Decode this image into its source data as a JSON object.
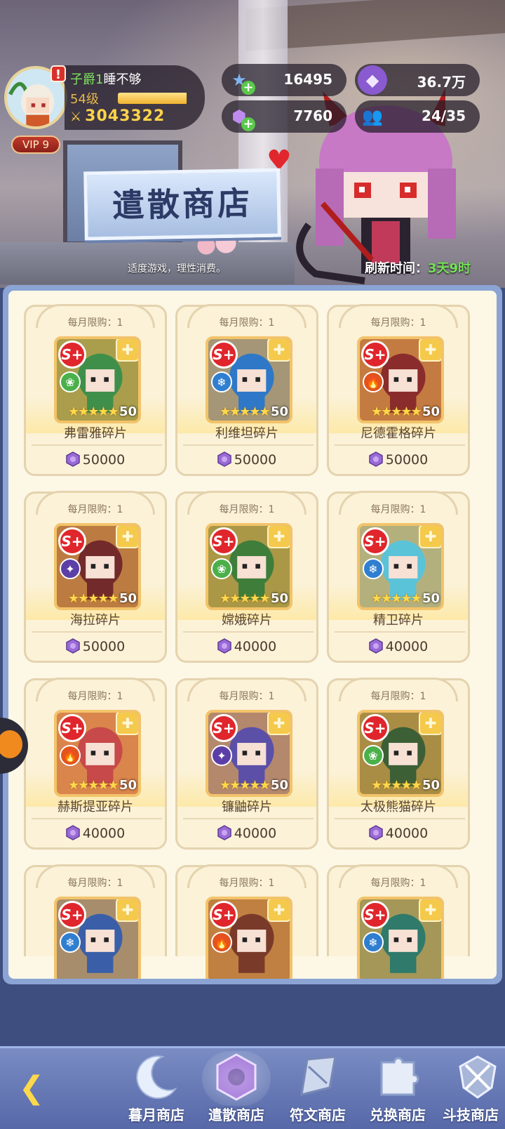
{
  "player": {
    "title": "子爵1",
    "name": "睡不够",
    "level": "54级",
    "exp_fraction": 0.98,
    "power": "3043322",
    "vip": "VIP 9",
    "alert": "!"
  },
  "resources": {
    "star": "16495",
    "crystal": "36.7万",
    "gem": "7760",
    "team": "24/35"
  },
  "store": {
    "title": "遣散商店",
    "notice": "适度游戏，理性消费。",
    "refresh_label": "刷新时间：",
    "refresh_value": "3天9时"
  },
  "items": [
    {
      "limit": "每月限购：1",
      "name": "弗雷雅碎片",
      "price": "50000",
      "rank": "S+",
      "element": "wind",
      "stars": "★★★★★",
      "level": "50"
    },
    {
      "limit": "每月限购：1",
      "name": "利维坦碎片",
      "price": "50000",
      "rank": "S+",
      "element": "ice",
      "stars": "★★★★★",
      "level": "50"
    },
    {
      "limit": "每月限购：1",
      "name": "尼德霍格碎片",
      "price": "50000",
      "rank": "S+",
      "element": "fire",
      "stars": "★★★★★",
      "level": "50"
    },
    {
      "limit": "每月限购：1",
      "name": "海拉碎片",
      "price": "50000",
      "rank": "S+",
      "element": "dark",
      "stars": "★★★★★",
      "level": "50"
    },
    {
      "limit": "每月限购：1",
      "name": "嫦娥碎片",
      "price": "40000",
      "rank": "S+",
      "element": "wind",
      "stars": "★★★★★",
      "level": "50"
    },
    {
      "limit": "每月限购：1",
      "name": "精卫碎片",
      "price": "40000",
      "rank": "S+",
      "element": "ice",
      "stars": "★★★★★",
      "level": "50"
    },
    {
      "limit": "每月限购：1",
      "name": "赫斯提亚碎片",
      "price": "40000",
      "rank": "S+",
      "element": "fire",
      "stars": "★★★★★",
      "level": "50"
    },
    {
      "limit": "每月限购：1",
      "name": "镰鼬碎片",
      "price": "40000",
      "rank": "S+",
      "element": "dark",
      "stars": "★★★★★",
      "level": "50"
    },
    {
      "limit": "每月限购：1",
      "name": "太极熊猫碎片",
      "price": "40000",
      "rank": "S+",
      "element": "wind",
      "stars": "★★★★★",
      "level": "50"
    },
    {
      "limit": "每月限购：1",
      "rank": "S+",
      "element": "ice"
    },
    {
      "limit": "每月限购：1",
      "rank": "S+",
      "element": "fire"
    },
    {
      "limit": "每月限购：1",
      "rank": "S+",
      "element": "ice"
    }
  ],
  "nav": [
    {
      "label": "暮月商店",
      "icon": "moon-icon",
      "active": false
    },
    {
      "label": "遣散商店",
      "icon": "crystal-icon",
      "active": true
    },
    {
      "label": "符文商店",
      "icon": "rune-icon",
      "active": false
    },
    {
      "label": "兑换商店",
      "icon": "puzzle-icon",
      "active": false
    },
    {
      "label": "斗技商店",
      "icon": "arena-icon",
      "active": false
    }
  ],
  "colors": {
    "accent_green": "#77e25a",
    "gold": "#ffd34a",
    "rank_red": "#e0262c",
    "gem_purple": "#9a6ad6"
  }
}
